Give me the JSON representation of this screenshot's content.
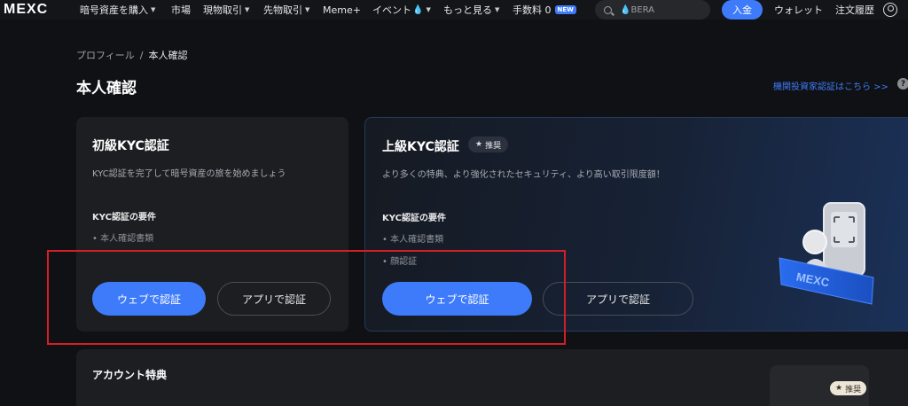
{
  "nav": {
    "logo": "MEXC",
    "items": [
      {
        "label": "暗号資産を購入",
        "caret": "▼"
      },
      {
        "label": "市場"
      },
      {
        "label": "現物取引",
        "caret": "▼"
      },
      {
        "label": "先物取引",
        "caret": "▼"
      },
      {
        "label": "Meme+"
      },
      {
        "label": "イベント",
        "drop_icon": "💧",
        "caret": "▼"
      },
      {
        "label": "もっと見る",
        "caret": "▼"
      },
      {
        "label": "手数料 0",
        "badge": "NEW"
      }
    ],
    "search_placeholder": "BERA",
    "search_drop": "💧",
    "deposit": "入金",
    "wallet": "ウォレット",
    "orders": "注文履歴",
    "user_icon": "user-icon"
  },
  "breadcrumb": {
    "parent": "プロフィール",
    "sep": "/",
    "current": "本人確認"
  },
  "page_title": "本人確認",
  "inst_link": "機関投資家認証はこちら >>",
  "help_symbol": "?",
  "basic": {
    "title": "初級KYC認証",
    "desc": "KYC認証を完了して暗号資産の旅を始めましょう",
    "req_title": "KYC認証の要件",
    "requirements": [
      "• 本人確認書類"
    ],
    "web_button": "ウェブで認証",
    "app_button": "アプリで認証"
  },
  "advanced": {
    "title": "上級KYC認証",
    "badge": "推奨",
    "badge_star": "★",
    "desc": "より多くの特典、より強化されたセキュリティ、より高い取引限度額！",
    "req_title": "KYC認証の要件",
    "requirements": [
      "• 本人確認書類",
      "• 顔認証"
    ],
    "web_button": "ウェブで認証",
    "app_button": "アプリで認証",
    "illustration_text": "MEXC"
  },
  "benefits": {
    "title": "アカウント特典",
    "badge": "推奨",
    "badge_star": "★"
  },
  "colors": {
    "accent": "#3e7bfa",
    "highlight": "#d41f24",
    "background": "#101114",
    "card": "#1d1e22"
  }
}
